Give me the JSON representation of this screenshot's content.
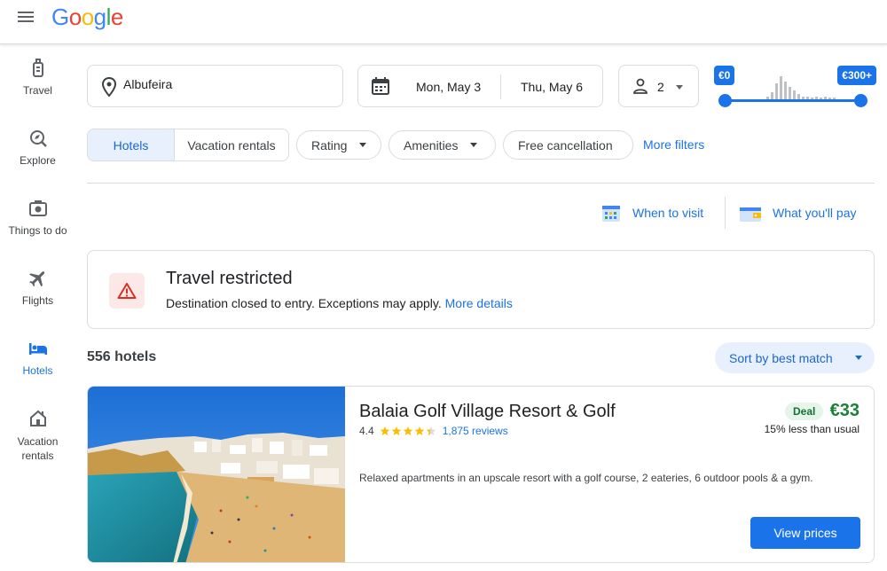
{
  "header": {
    "logo_letters": [
      {
        "ch": "G",
        "color": "#4285F4"
      },
      {
        "ch": "o",
        "color": "#EA4335"
      },
      {
        "ch": "o",
        "color": "#FBBC05"
      },
      {
        "ch": "g",
        "color": "#4285F4"
      },
      {
        "ch": "l",
        "color": "#34A853"
      },
      {
        "ch": "e",
        "color": "#EA4335"
      }
    ]
  },
  "sidebar": {
    "items": [
      {
        "label": "Travel",
        "icon": "luggage-icon",
        "active": false
      },
      {
        "label": "Explore",
        "icon": "explore-icon",
        "active": false
      },
      {
        "label": "Things to do",
        "icon": "camera-icon",
        "active": false
      },
      {
        "label": "Flights",
        "icon": "airplane-icon",
        "active": false
      },
      {
        "label": "Hotels",
        "icon": "bed-icon",
        "active": true
      },
      {
        "label": "Vacation rentals",
        "icon": "house-icon",
        "active": false
      }
    ]
  },
  "search": {
    "location": "Albufeira",
    "checkin": "Mon, May 3",
    "checkout": "Thu, May 6",
    "guests": "2",
    "price_min": "€0",
    "price_max": "€300+",
    "price_min_fraction": 0,
    "price_max_fraction": 1
  },
  "filters": {
    "tab_hotels": "Hotels",
    "tab_rentals": "Vacation rentals",
    "rating": "Rating",
    "amenities": "Amenities",
    "free_cancellation": "Free cancellation",
    "more_filters": "More filters"
  },
  "insights": {
    "when_to_visit": "When to visit",
    "what_youll_pay": "What you'll pay"
  },
  "alert": {
    "title": "Travel restricted",
    "text": "Destination closed to entry. Exceptions may apply.",
    "link": "More details"
  },
  "results": {
    "count": "556 hotels",
    "sort": "Sort by best match"
  },
  "hotel": {
    "name": "Balaia Golf Village Resort & Golf",
    "rating": "4.4",
    "stars_value": 4.4,
    "reviews": "1,875 reviews",
    "deal_badge": "Deal",
    "price": "€33",
    "price_note": "15% less than usual",
    "description": "Relaxed apartments in an upscale resort with a golf course, 2 eateries, 6 outdoor pools & a gym.",
    "view_button": "View prices"
  },
  "colors": {
    "accent": "#1a73e8",
    "deal_green": "#188038",
    "warning_red": "#d93025",
    "star": "#fbbc04"
  }
}
